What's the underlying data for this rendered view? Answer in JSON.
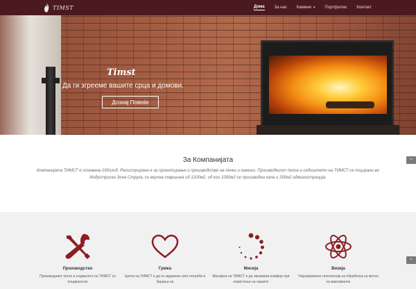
{
  "brand": {
    "name": "TIMST"
  },
  "nav": {
    "items": [
      {
        "label": "Дома",
        "active": true
      },
      {
        "label": "За нас",
        "active": false
      },
      {
        "label": "Камини",
        "active": false,
        "has_dropdown": true
      },
      {
        "label": "Портфолио",
        "active": false
      },
      {
        "label": "Контакт",
        "active": false
      }
    ]
  },
  "hero": {
    "title": "Timst",
    "subtitle": "Да ги згрееме вашите срца и домови.",
    "button_label": "Дознај Повеќе"
  },
  "about": {
    "title": "За Компанијата",
    "text": "Компанијата ТИМСТ е основана 1991год. Регистрирана е за проектирање и производство на печки и камини. Производниот погон и седиштето на ТИМСТ се поцирани во Индустриска Зона Струга, со вкупна површина од 1200м2, од кои 1000м2 се производна хала и 200м2 администрација."
  },
  "features": [
    {
      "icon": "tools-icon",
      "title": "Производство",
      "text": "Производниот погон и седиштето на ТИМСТ се поцирани во"
    },
    {
      "icon": "heart-icon",
      "title": "Грижа",
      "text": "Целта на ТИМСТ е да ги задоволи сите потреби и барања на"
    },
    {
      "icon": "dots-circle-icon",
      "title": "Мисија",
      "text": "Мисијата на ТИМСТ е да овозможи комфор при користење на нашите"
    },
    {
      "icon": "atom-icon",
      "title": "Визија",
      "text": "Најсовремена технологија за обработка на метал за максимално"
    }
  ],
  "colors": {
    "nav_bg": "#4a1a1e",
    "accent": "#8b1e24",
    "features_bg": "#f1f1f1"
  },
  "scroll_buttons": {
    "symbol": "⌃"
  }
}
